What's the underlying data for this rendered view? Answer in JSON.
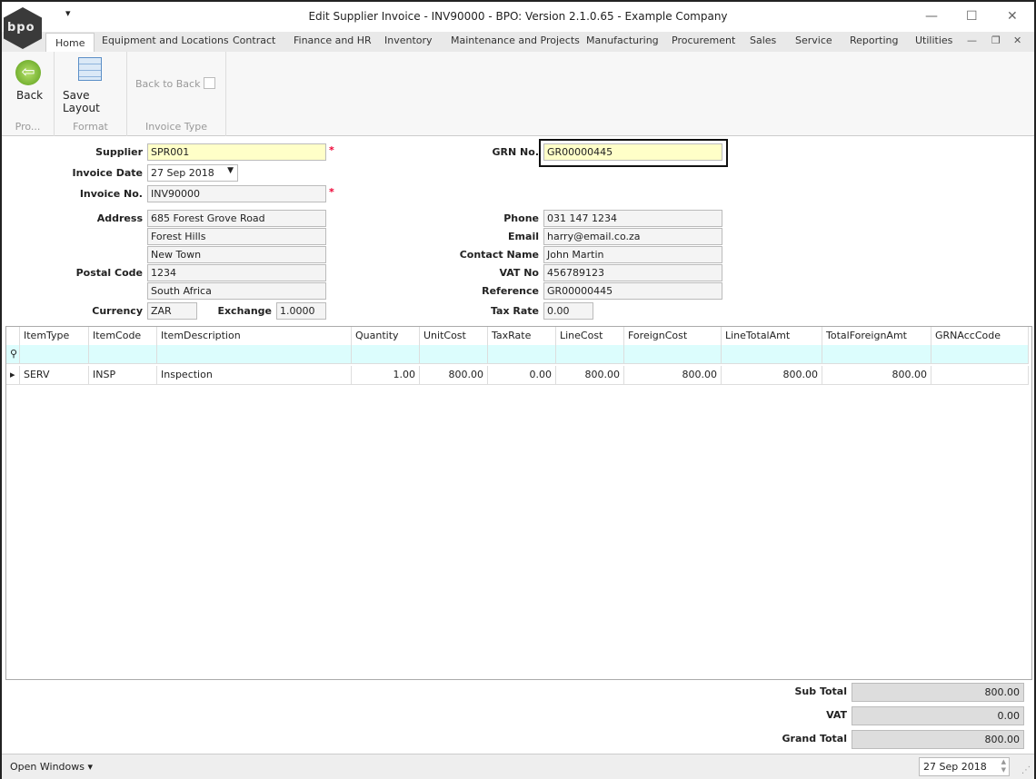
{
  "window": {
    "title": "Edit Supplier Invoice - INV90000 - BPO: Version 2.1.0.65 - Example Company",
    "logo_text": "bpo",
    "minimize": "—",
    "maximize": "☐",
    "close": "✕",
    "qat": "▾"
  },
  "tabs": [
    "Home",
    "Equipment and Locations",
    "Contract",
    "Finance and HR",
    "Inventory",
    "Maintenance and Projects",
    "Manufacturing",
    "Procurement",
    "Sales",
    "Service",
    "Reporting",
    "Utilities"
  ],
  "ribbon": {
    "back": "Back",
    "save_layout": "Save Layout",
    "back_to_back": "Back to Back",
    "groups": [
      "Pro...",
      "Format",
      "Invoice Type"
    ]
  },
  "form": {
    "supplier_label": "Supplier",
    "supplier": "SPR001",
    "invoice_date_label": "Invoice Date",
    "invoice_date": "27 Sep 2018",
    "invoice_no_label": "Invoice No.",
    "invoice_no": "INV90000",
    "address_label": "Address",
    "address": [
      "685 Forest Grove Road",
      "Forest Hills",
      "New Town"
    ],
    "postal_code_label": "Postal Code",
    "postal_code": "1234",
    "country": "South Africa",
    "currency_label": "Currency",
    "currency": "ZAR",
    "exchange_label": "Exchange",
    "exchange": "1.0000",
    "grn_label": "GRN No.",
    "grn": "GR00000445",
    "phone_label": "Phone",
    "phone": "031 147 1234",
    "email_label": "Email",
    "email": "harry@email.co.za",
    "contact_label": "Contact Name",
    "contact": "John Martin",
    "vat_label": "VAT No",
    "vat": "456789123",
    "reference_label": "Reference",
    "reference": "GR00000445",
    "tax_rate_label": "Tax Rate",
    "tax_rate": "0.00",
    "required": "*"
  },
  "grid": {
    "columns": [
      "ItemType",
      "ItemCode",
      "ItemDescription",
      "Quantity",
      "UnitCost",
      "TaxRate",
      "LineCost",
      "ForeignCost",
      "LineTotalAmt",
      "TotalForeignAmt",
      "GRNAccCode"
    ],
    "rows": [
      [
        "SERV",
        "INSP",
        "Inspection",
        "1.00",
        "800.00",
        "0.00",
        "800.00",
        "800.00",
        "800.00",
        "800.00",
        ""
      ]
    ]
  },
  "totals": {
    "sub_total_label": "Sub Total",
    "sub_total": "800.00",
    "vat_label": "VAT",
    "vat": "0.00",
    "grand_total_label": "Grand Total",
    "grand_total": "800.00"
  },
  "status": {
    "open_windows": "Open Windows ▾",
    "date": "27 Sep 2018"
  }
}
